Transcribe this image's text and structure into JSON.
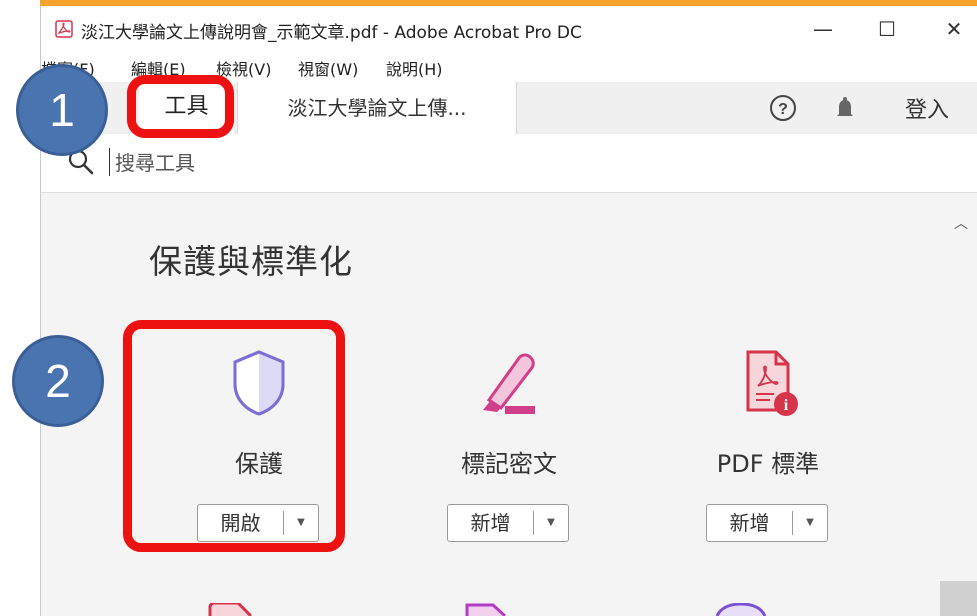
{
  "window": {
    "title": "淡江大學論文上傳說明會_示範文章.pdf - Adobe Acrobat Pro DC",
    "minimize": "—",
    "maximize": "☐",
    "close": "✕"
  },
  "menu": [
    "檔案(F)",
    "編輯(E)",
    "檢視(V)",
    "視窗(W)",
    "說明(H)"
  ],
  "tabs": {
    "tools": "工具",
    "document": "淡江大學論文上傳..."
  },
  "header": {
    "help_icon": "question-circle-icon",
    "bell_icon": "bell-icon",
    "sign_in": "登入"
  },
  "search": {
    "placeholder": "搜尋工具",
    "value": ""
  },
  "section": {
    "title": "保護與標準化",
    "tools": [
      {
        "name": "保護",
        "button": "開啟",
        "icon": "shield-icon",
        "color": "#7b6fd6"
      },
      {
        "name": "標記密文",
        "button": "新增",
        "icon": "redact-marker-icon",
        "color": "#d13f8a"
      },
      {
        "name": "PDF 標準",
        "button": "新增",
        "icon": "pdf-standards-icon",
        "color": "#d6344a"
      }
    ]
  },
  "annotations": {
    "step1": "1",
    "step2": "2",
    "badge_color": "#4a74b0",
    "highlight_color": "#ee1111"
  }
}
